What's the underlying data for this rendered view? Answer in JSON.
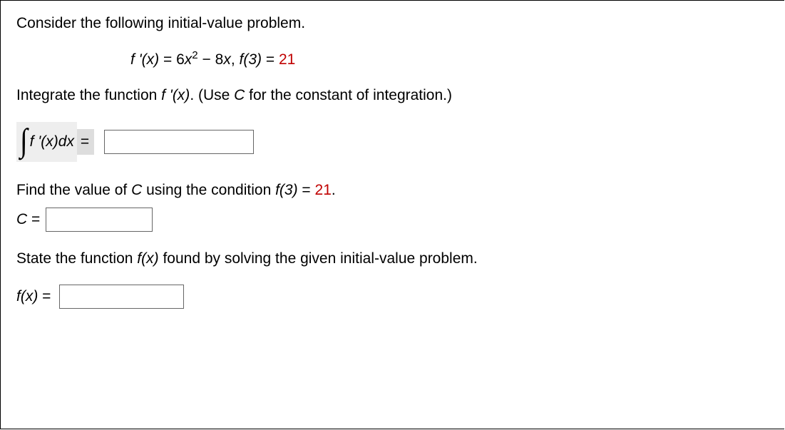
{
  "intro": "Consider the following initial-value problem.",
  "equation": {
    "lhs": "f '(x)",
    "eq": " = ",
    "coef1": "6",
    "var1": "x",
    "exp1": "2",
    "minus": " − ",
    "coef2": "8",
    "var2": "x",
    "comma": ", ",
    "cond_lhs": "f(3)",
    "cond_eq": " = ",
    "cond_val": "21"
  },
  "integrate_prompt_a": "Integrate the function ",
  "integrate_prompt_fx": "f '(x)",
  "integrate_prompt_b": ". (Use ",
  "integrate_prompt_c": "C",
  "integrate_prompt_d": " for the constant of integration.)",
  "integral_lhs": "f '(x)dx",
  "integral_eq": "=",
  "find_c_a": "Find the value of ",
  "find_c_C": "C",
  "find_c_b": " using the condition ",
  "find_c_cond": "f(3)",
  "find_c_eq": " = ",
  "find_c_val": "21",
  "find_c_period": ".",
  "c_label": "C",
  "c_eq": " = ",
  "state_prompt_a": "State the function ",
  "state_prompt_fx": "f(x)",
  "state_prompt_b": " found by solving the given initial-value problem.",
  "fx_label": "f(x)",
  "fx_eq": " = ",
  "chart_data": null
}
